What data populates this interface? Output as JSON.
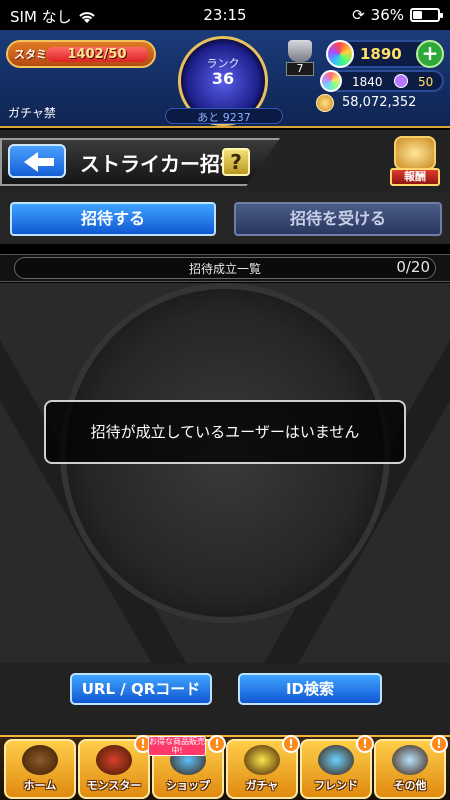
{
  "status_bar": {
    "carrier": "SIM なし",
    "time": "23:15",
    "battery_percent": "36%",
    "battery_level": 0.36
  },
  "header": {
    "stamina_label": "スタミナ",
    "stamina_text": "1402/50",
    "stamina_fill": 1.0,
    "rank_label": "ランク",
    "rank_value": "36",
    "rank_next": "あと 9237",
    "gacha_ban": "ガチャ禁",
    "trophy_count": "7",
    "orb_count": "1890",
    "sub_orb_count": "1840",
    "sub_item_count": "50",
    "coin_count": "58,072,352"
  },
  "title_bar": {
    "title": "ストライカー招待",
    "help_label": "?",
    "reward_label": "報酬"
  },
  "tabs": [
    {
      "label": "招待する",
      "active": true
    },
    {
      "label": "招待を受ける",
      "active": false
    }
  ],
  "list": {
    "title": "招待成立一覧",
    "count": "0/20",
    "empty_message": "招待が成立しているユーザーはいません"
  },
  "actions": {
    "url_qr_label": "URL / QRコード",
    "id_search_label": "ID検索"
  },
  "bottom_nav": {
    "items": [
      {
        "label": "ホーム",
        "icon": "home-icon",
        "badge": ""
      },
      {
        "label": "モンスター",
        "icon": "monster-icon",
        "badge": "!"
      },
      {
        "label": "ショップ",
        "icon": "shop-icon",
        "badge": "!"
      },
      {
        "label": "ガチャ",
        "icon": "gacha-icon",
        "badge": "!"
      },
      {
        "label": "フレンド",
        "icon": "friend-icon",
        "badge": "!"
      },
      {
        "label": "その他",
        "icon": "other-icon",
        "badge": "!"
      }
    ],
    "shop_tag": "お得な商品販売中!"
  },
  "colors": {
    "accent_blue": "#1157d2",
    "gold": "#e08a10",
    "orb_yellow": "#ffe066"
  }
}
